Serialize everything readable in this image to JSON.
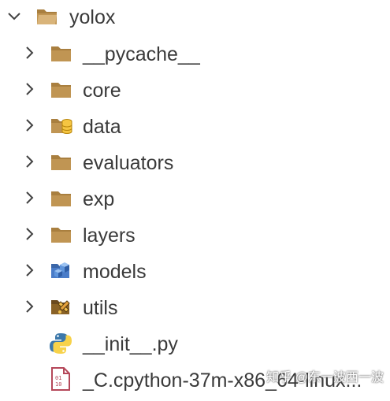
{
  "explorer": {
    "root": {
      "label": "yolox",
      "icon": "folder-open-icon",
      "expanded": true
    },
    "items": [
      {
        "label": "__pycache__",
        "icon": "folder-icon",
        "collapsible": true
      },
      {
        "label": "core",
        "icon": "folder-icon",
        "collapsible": true
      },
      {
        "label": "data",
        "icon": "folder-database-icon",
        "collapsible": true
      },
      {
        "label": "evaluators",
        "icon": "folder-icon",
        "collapsible": true
      },
      {
        "label": "exp",
        "icon": "folder-icon",
        "collapsible": true
      },
      {
        "label": "layers",
        "icon": "folder-icon",
        "collapsible": true
      },
      {
        "label": "models",
        "icon": "folder-models-icon",
        "collapsible": true
      },
      {
        "label": "utils",
        "icon": "folder-utils-icon",
        "collapsible": true
      },
      {
        "label": "__init__.py",
        "icon": "python-icon",
        "collapsible": false
      },
      {
        "label": "_C.cpython-37m-x86_64-linux...",
        "icon": "binary-file-icon",
        "collapsible": false
      }
    ]
  },
  "watermark": "知乎 @东一波西一波",
  "colors": {
    "folder": "#c09553",
    "folder_dark": "#a97f3f",
    "chevron": "#424242",
    "text": "#3a3a3a",
    "python_blue": "#3c78aa",
    "python_yellow": "#f7d24a",
    "models_blue": "#4a7cc8",
    "binary_red": "#b5485a"
  }
}
